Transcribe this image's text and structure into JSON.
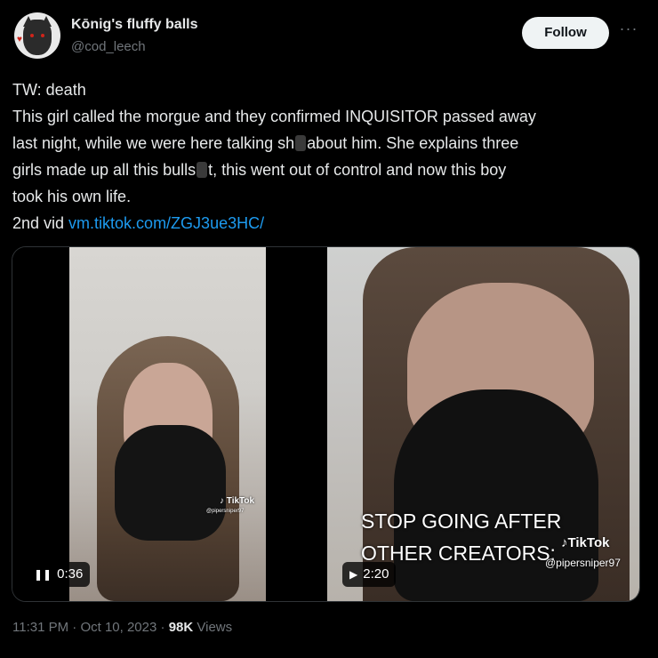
{
  "author": {
    "name": "Kōnig's fluffy balls",
    "handle": "@cod_leech",
    "follow_label": "Follow",
    "more_icon": "more-dots-icon"
  },
  "tweet": {
    "lines": [
      "TW: death",
      "This girl called the morgue and they confirmed INQUISITOR passed away",
      "last night, while we were here talking sh",
      "about him. She explains three",
      "girls made up all this bulls",
      "t, this went out of control and now this boy",
      "took his own life.",
      "2nd vid "
    ],
    "link": "vm.tiktok.com/ZGJ3ue3HC/"
  },
  "media": {
    "video1": {
      "time": "0:36",
      "state_icon": "pause-icon",
      "watermark": "TikTok",
      "watermark_handle": "@pipersniper97"
    },
    "video2": {
      "time": "2:20",
      "state_icon": "play-icon",
      "caption_line1": "STOP GOING AFTER",
      "caption_line2": "OTHER CREATORS:",
      "watermark": "TikTok",
      "watermark_handle": "@pipersniper97"
    }
  },
  "meta": {
    "time": "11:31 PM",
    "sep1": " · ",
    "date": "Oct 10, 2023",
    "sep2": " · ",
    "views_count": "98K",
    "views_label": " Views"
  },
  "colors": {
    "background": "#000000",
    "text": "#e7e9ea",
    "muted": "#71767b",
    "link": "#1d9bf0"
  }
}
